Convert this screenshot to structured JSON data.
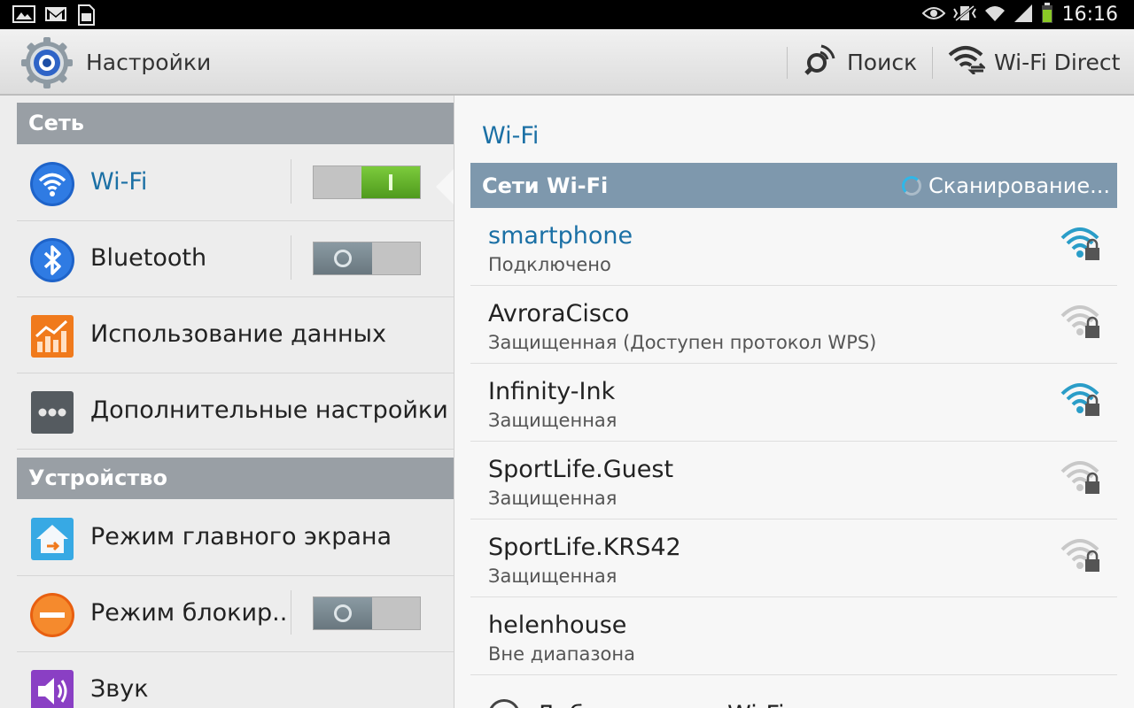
{
  "status_bar": {
    "time": "16:16",
    "left_icons": [
      "gallery-icon",
      "gmail-icon",
      "sim-card-icon"
    ],
    "right_icons": [
      "eye-icon",
      "vibrate-icon",
      "wifi-status-icon",
      "cell-signal-icon",
      "battery-icon"
    ],
    "battery_color": "#8ac926"
  },
  "action_bar": {
    "title": "Настройки",
    "search_label": "Поиск",
    "wifi_direct_label": "Wi-Fi Direct"
  },
  "left_panel": {
    "section_network": "Сеть",
    "section_device": "Устройство",
    "items": [
      {
        "label": "Wi-Fi",
        "icon": "wifi-icon",
        "toggle": "on",
        "active": true
      },
      {
        "label": "Bluetooth",
        "icon": "bluetooth-icon",
        "toggle": "off"
      },
      {
        "label": "Использование данных",
        "icon": "data-usage-icon"
      },
      {
        "label": "Дополнительные настройки",
        "icon": "more-settings-icon"
      },
      {
        "label": "Режим главного экрана",
        "icon": "home-screen-icon"
      },
      {
        "label": "Режим блокир..",
        "icon": "blocking-mode-icon",
        "toggle": "off"
      },
      {
        "label": "Звук",
        "icon": "sound-icon"
      }
    ]
  },
  "right_panel": {
    "title": "Wi-Fi",
    "networks_header": "Сети Wi-Fi",
    "scanning_label": "Сканирование...",
    "networks": [
      {
        "name": "smartphone",
        "status": "Подключено",
        "connected": true,
        "signal_color": "#2a9dc8"
      },
      {
        "name": "AvroraCisco",
        "status": "Защищенная (Доступен протокол WPS)",
        "signal_color": "#c8c8c8"
      },
      {
        "name": "Infinity-Ink",
        "status": "Защищенная",
        "signal_color": "#2a9dc8"
      },
      {
        "name": "SportLife.Guest",
        "status": "Защищенная",
        "signal_color": "#c8c8c8"
      },
      {
        "name": "SportLife.KRS42",
        "status": "Защищенная",
        "signal_color": "#c8c8c8"
      },
      {
        "name": "helenhouse",
        "status": "Вне диапазона"
      }
    ],
    "add_network_label": "Добавить сеть Wi-Fi"
  },
  "colors": {
    "accent": "#1b70a5",
    "section_header": "#999fa5",
    "networks_header": "#7e98ad",
    "toggle_on": "#5faa2a"
  }
}
